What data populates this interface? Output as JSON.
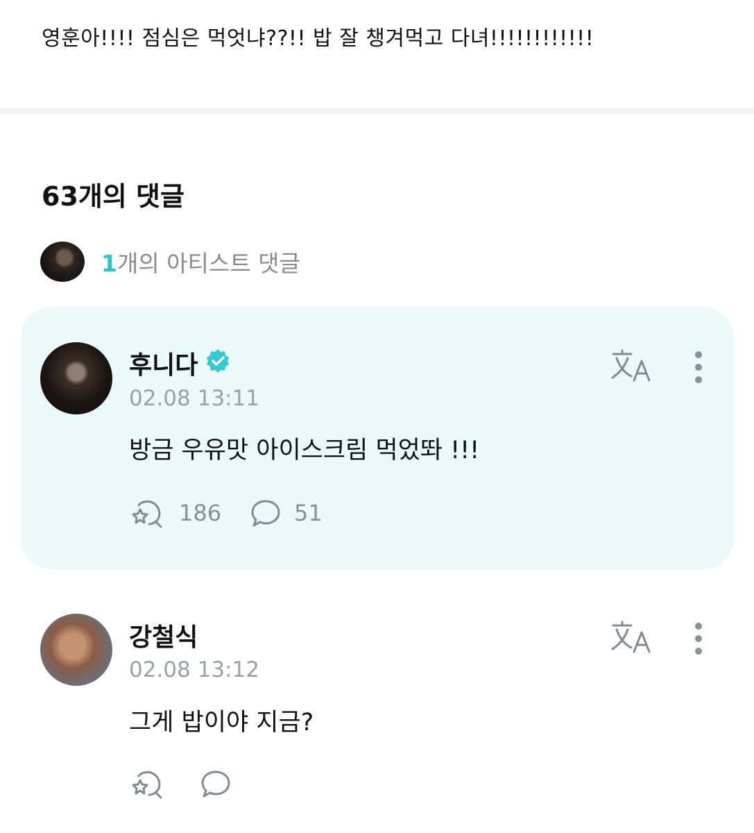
{
  "post": {
    "body": "영훈아!!!! 점심은 먹엇냐??!! 밥 잘 챙겨먹고 다녀!!!!!!!!!!!!"
  },
  "comments": {
    "title": "63개의 댓글",
    "artist_summary": {
      "count": "1",
      "label": "개의 아티스트 댓글"
    },
    "items": [
      {
        "author": "후니다",
        "verified": true,
        "timestamp": "02.08 13:11",
        "text": "방금 우유맛 아이스크림 먹었똬 !!!",
        "reactions": "186",
        "replies": "51"
      },
      {
        "author": "강철식",
        "verified": false,
        "timestamp": "02.08 13:12",
        "text": "그게 밥이야 지금?"
      }
    ]
  },
  "icons": {
    "translate": "translate-icon",
    "more": "more-vertical-icon",
    "reaction": "reaction-icon",
    "reply": "reply-icon",
    "verified": "verified-badge-icon"
  },
  "colors": {
    "accent": "#22c7c7",
    "artist_card_bg": "#e9faf8",
    "muted_text": "#9aa0a6"
  }
}
